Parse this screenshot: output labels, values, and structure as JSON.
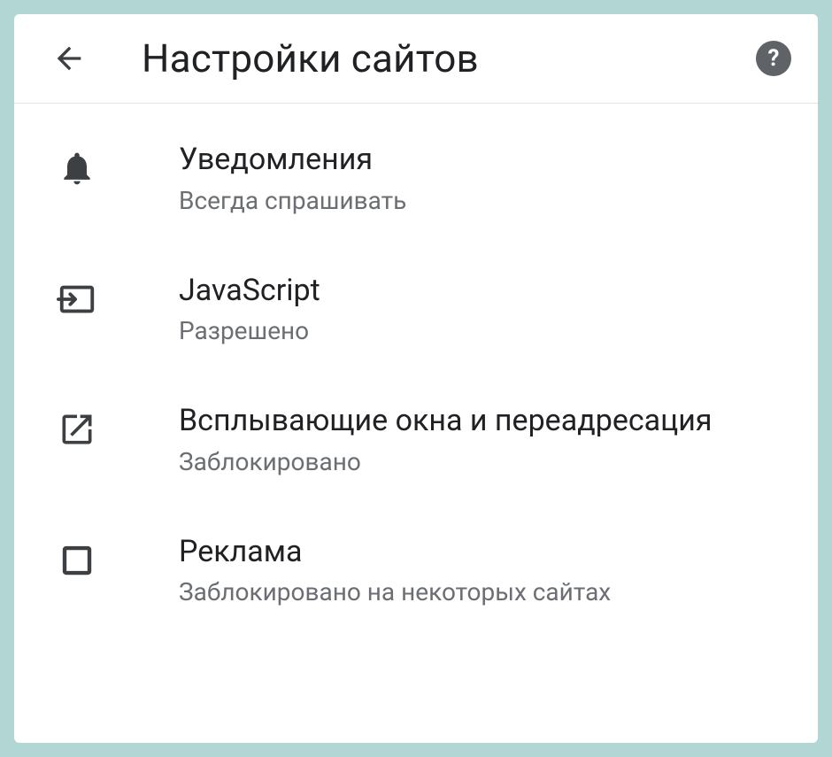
{
  "header": {
    "title": "Настройки сайтов"
  },
  "items": [
    {
      "icon": "bell-icon",
      "title": "Уведомления",
      "subtitle": "Всегда спрашивать"
    },
    {
      "icon": "input-icon",
      "title": "JavaScript",
      "subtitle": "Разрешено"
    },
    {
      "icon": "open-in-new-icon",
      "title": "Всплывающие окна и переадресация",
      "subtitle": "Заблокировано"
    },
    {
      "icon": "square-icon",
      "title": "Реклама",
      "subtitle": "Заблокировано на некоторых сайтах"
    }
  ]
}
